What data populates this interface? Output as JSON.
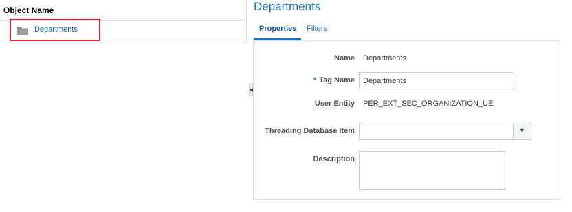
{
  "tree": {
    "column_header": "Object Name",
    "items": [
      {
        "label": "Departments",
        "icon": "folder-icon"
      }
    ]
  },
  "detail": {
    "title": "Departments",
    "tabs": [
      {
        "label": "Properties",
        "active": true
      },
      {
        "label": "Filters",
        "active": false
      }
    ],
    "fields": {
      "name_label": "Name",
      "name_value": "Departments",
      "tag_required_mark": "*",
      "tag_label": "Tag Name",
      "tag_value": "Departments",
      "user_entity_label": "User Entity",
      "user_entity_value": "PER_EXT_SEC_ORGANIZATION_UE",
      "threading_label": "Threading Database Item",
      "threading_value": "",
      "description_label": "Description",
      "description_value": ""
    }
  },
  "colors": {
    "accent": "#1b72c6",
    "highlight": "#e0202a",
    "border": "#d6dfe6"
  }
}
